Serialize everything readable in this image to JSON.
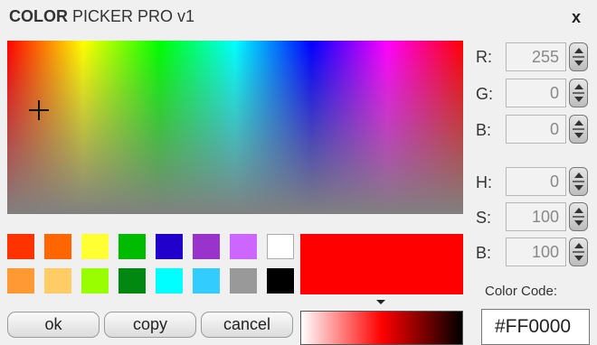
{
  "window": {
    "title_bold": "COLOR",
    "title_rest": "PICKER PRO v1",
    "close_label": "x"
  },
  "spectrum": {
    "hue_stops": [
      "#ff0000",
      "#ffff00",
      "#00ff00",
      "#00ffff",
      "#0000ff",
      "#ff00ff",
      "#ff0000"
    ],
    "bottom_tint": "#808080"
  },
  "swatches": {
    "row1": [
      "#ff3300",
      "#ff6600",
      "#ffff33",
      "#00bb00",
      "#2200cc",
      "#9933cc",
      "#cc66ff",
      "#ffffff"
    ],
    "row2": [
      "#ff9933",
      "#ffcc66",
      "#99ff00",
      "#008811",
      "#00ffff",
      "#33ccff",
      "#999999",
      "#000000"
    ]
  },
  "preview": {
    "color": "#ff0000",
    "gradient": [
      "#ffffff",
      "#ff0000",
      "#000000"
    ]
  },
  "buttons": {
    "ok": "ok",
    "copy": "copy",
    "cancel": "cancel"
  },
  "rgb": {
    "r_label": "R:",
    "r_value": "255",
    "g_label": "G:",
    "g_value": "0",
    "b_label": "B:",
    "b_value": "0"
  },
  "hsb": {
    "h_label": "H:",
    "h_value": "0",
    "s_label": "S:",
    "s_value": "100",
    "b_label": "B:",
    "b_value": "100"
  },
  "color_code": {
    "label": "Color Code:",
    "value": "#FF0000"
  }
}
